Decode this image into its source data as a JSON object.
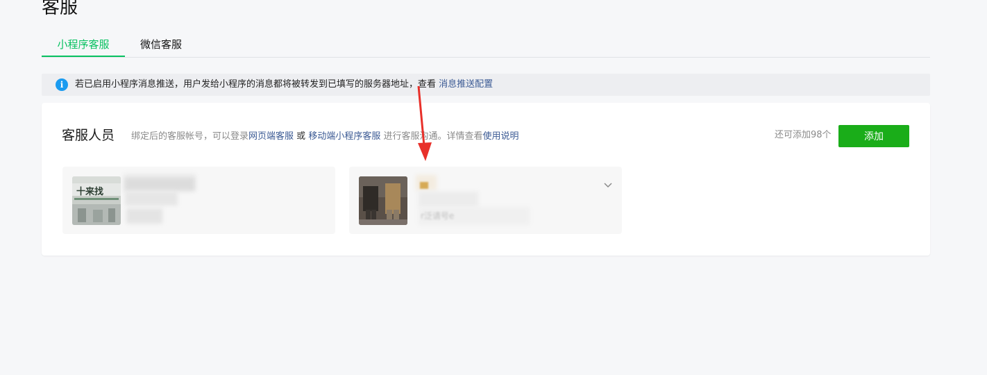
{
  "page": {
    "title": "客服"
  },
  "tabs": [
    {
      "label": "小程序客服",
      "active": true
    },
    {
      "label": "微信客服",
      "active": false
    }
  ],
  "notice": {
    "icon": "info-icon",
    "text": "若已启用小程序消息推送，用户发给小程序的消息都将被转发到已填写的服务器地址，查看",
    "link": "消息推送配置"
  },
  "staff": {
    "title": "客服人员",
    "desc_part1": "绑定后的客服帐号，可以登录",
    "link_web": "网页端客服",
    "or": "或",
    "link_mobile": "移动端小程序客服",
    "desc_part2": "进行客服沟通。详情查看",
    "link_help": "使用说明",
    "remaining": "还可添加98个",
    "add_label": "添加"
  },
  "agents": [
    {
      "name": "",
      "note": ""
    },
    {
      "name": "",
      "note": "r泛请号e"
    }
  ],
  "colors": {
    "accent_green": "#07c160",
    "button_green": "#1aad19",
    "link_blue": "#3b5a94",
    "info_blue": "#1a9bf0",
    "annotation_red": "#e8302a"
  }
}
